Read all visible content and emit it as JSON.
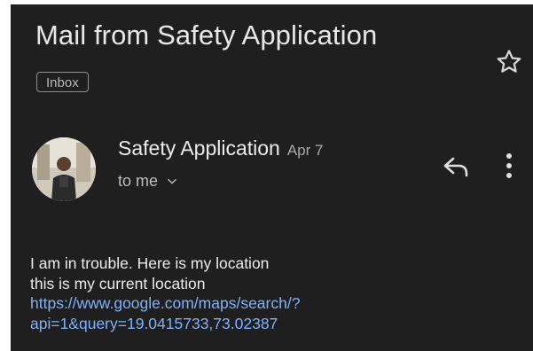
{
  "email": {
    "subject": "Mail from Safety Application",
    "label": "Inbox",
    "sender_name": "Safety Application",
    "date": "Apr 7",
    "recipient": "to me",
    "body_lines": [
      "I am in trouble. Here is my location",
      "this is my current location"
    ],
    "link_lines": [
      "https://www.google.com/maps/search/?",
      "api=1&query=19.0415733,73.02387"
    ]
  },
  "icons": {
    "star": "star-outline-icon",
    "reply": "reply-icon",
    "more": "more-vert-icon",
    "chevron": "chevron-down-icon"
  },
  "colors": {
    "background": "#1f1f1f",
    "text": "#ececec",
    "link": "#7fb1ff"
  }
}
